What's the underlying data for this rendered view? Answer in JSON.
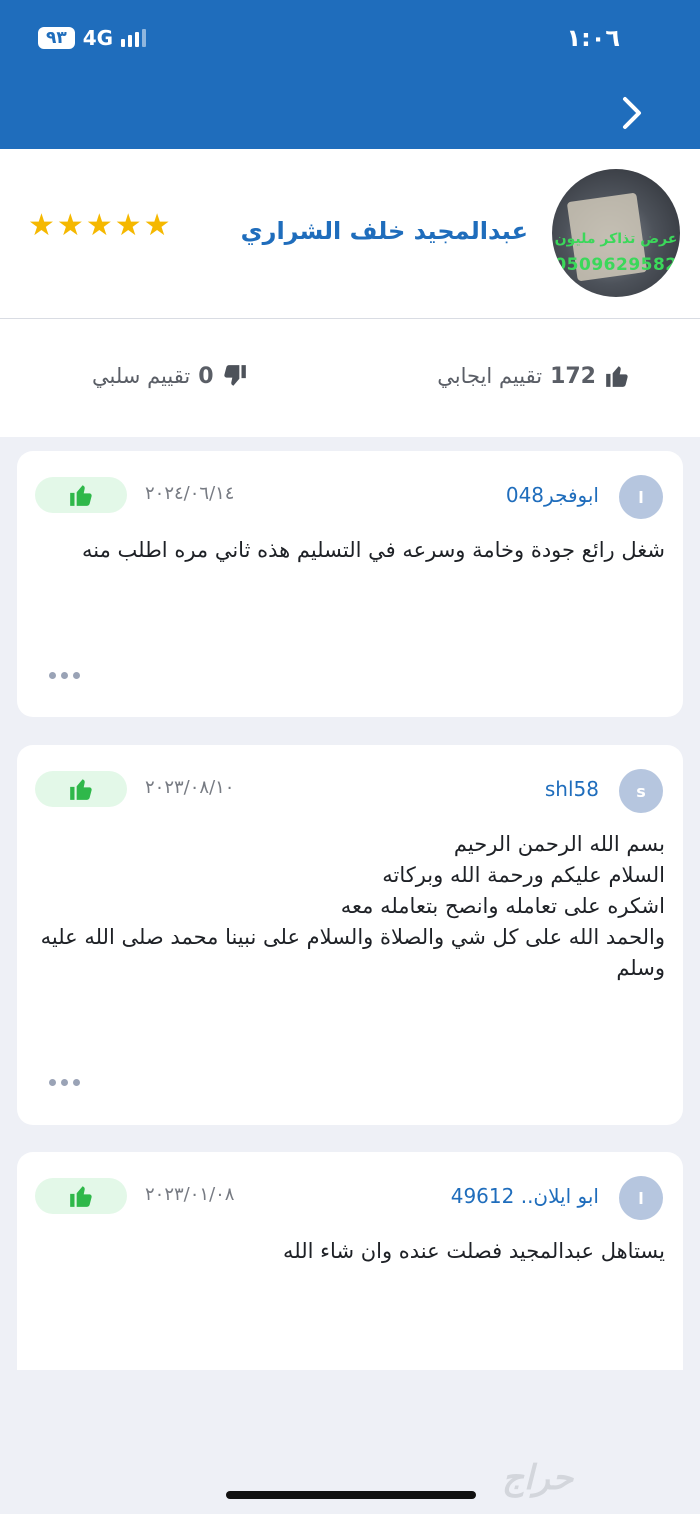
{
  "status_bar": {
    "time": "١:٠٦",
    "battery": "٩٣",
    "network": "4G"
  },
  "seller": {
    "name": "عبدالمجيد خلف الشراري",
    "avatar_text_1": "عرض تذاكر مليون",
    "avatar_text_2": "0509629582",
    "stars": "★★★★★"
  },
  "ratings": {
    "positive_count": "172",
    "positive_label": "تقييم ايجابي",
    "negative_count": "0",
    "negative_label": "تقييم سلبي"
  },
  "reviews": [
    {
      "initial": "ا",
      "user": "ابوفجر048",
      "date": "٢٠٢٤/٠٦/١٤",
      "text": "شغل رائع جودة وخامة وسرعه في التسليم هذه ثاني مره اطلب منه"
    },
    {
      "initial": "s",
      "user": "shl58",
      "date": "٢٠٢٣/٠٨/١٠",
      "text": "بسم الله الرحمن الرحيم\nالسلام عليكم ورحمة الله وبركاته\nاشكره على تعامله وانصح بتعامله معه\nوالحمد الله على كل شي والصلاة والسلام على نبينا محمد صلى الله عليه وسلم"
    },
    {
      "initial": "ا",
      "user": "ابو ايلان.. 49612",
      "date": "٢٠٢٣/٠١/٠٨",
      "text": "يستاهل عبدالمجيد فصلت عنده وان شاء الله"
    }
  ],
  "watermark": "حراج",
  "colors": {
    "brand_blue": "#1f6dbc",
    "star_gold": "#f5b800",
    "like_green": "#2fb84a",
    "like_bg": "#e3f8e8"
  },
  "icons": {
    "back": "chevron-right-icon",
    "like": "thumbs-up-icon",
    "dislike": "thumbs-down-icon",
    "more": "more-dots-icon"
  }
}
